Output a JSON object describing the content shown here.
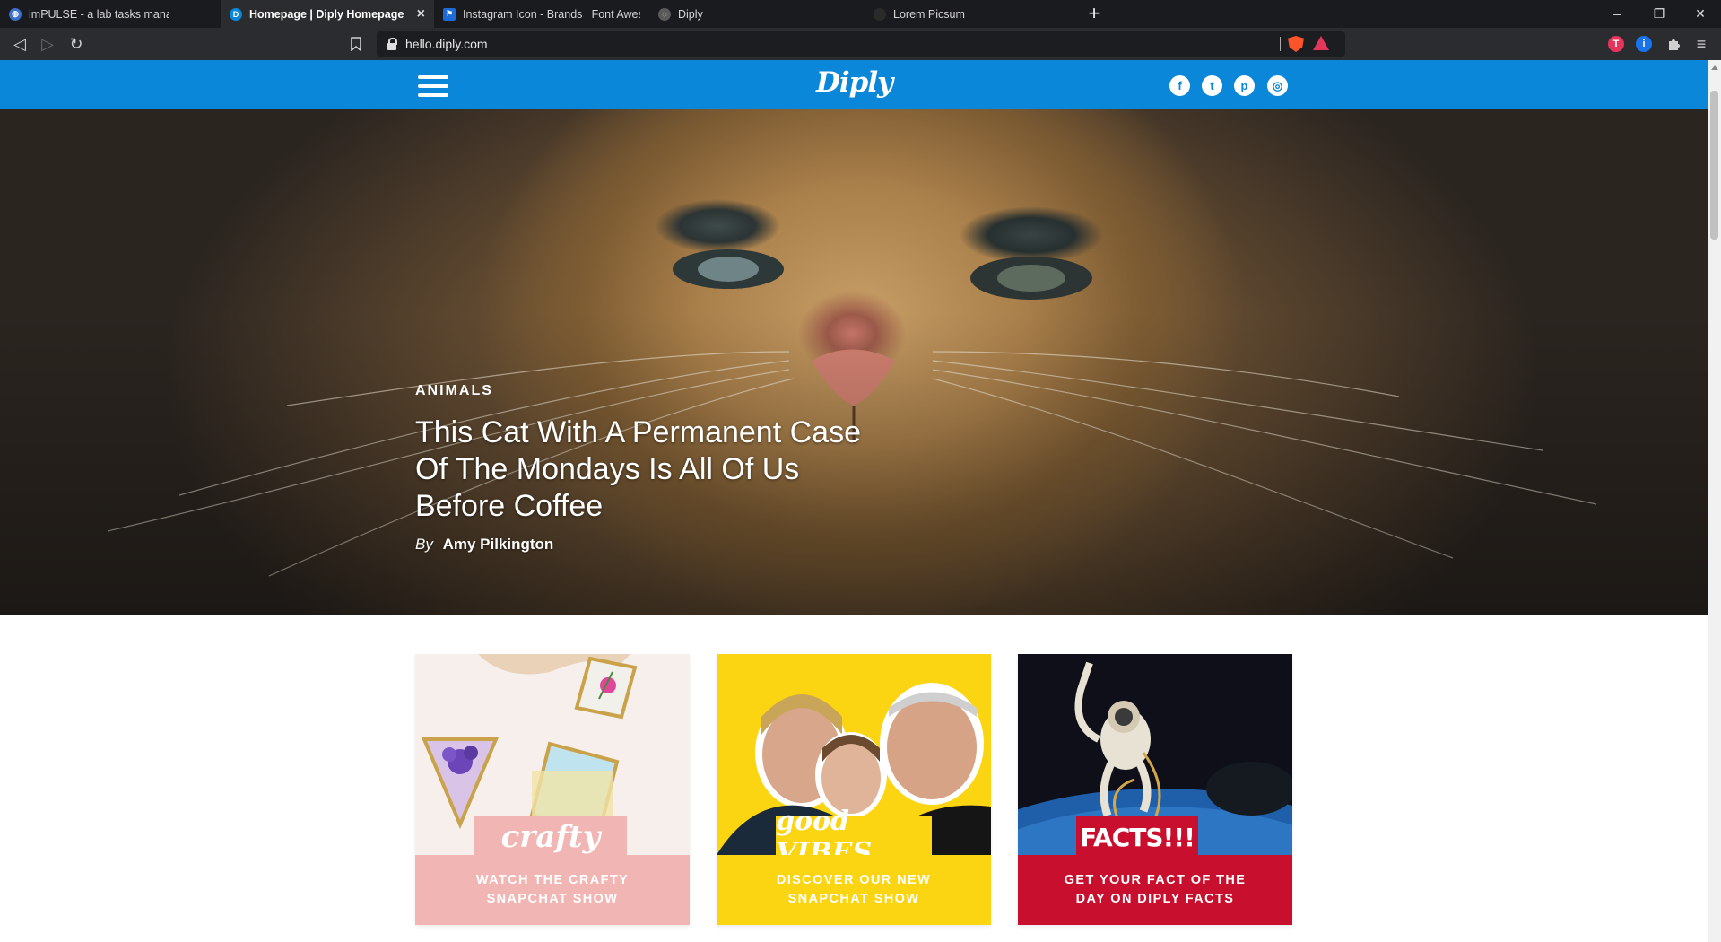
{
  "browser": {
    "tabs": [
      {
        "title": "imPULSE - a lab tasks management ap",
        "favicon_color": "#3a6fd0",
        "favicon_glyph": "◍",
        "active": false
      },
      {
        "title": "Homepage | Diply Homepage",
        "favicon_color": "#0a87d8",
        "favicon_glyph": "D",
        "active": true,
        "close": "×"
      },
      {
        "title": "Instagram Icon - Brands | Font Awesor",
        "favicon_color": "#1c6bd6",
        "favicon_glyph": "⚑",
        "active": false
      },
      {
        "title": "Diply",
        "favicon_color": "#5a5a5a",
        "favicon_glyph": "◌",
        "active": false
      },
      {
        "title": "Lorem Picsum",
        "favicon_color": "#2a2a2a",
        "favicon_glyph": "",
        "active": false
      }
    ],
    "new_tab": "+",
    "window_controls": {
      "minimize": "–",
      "restore": "❐",
      "close": "✕"
    },
    "nav": {
      "back": "◁",
      "forward": "▷",
      "reload": "↻",
      "bookmark": "🔖"
    },
    "url": "hello.diply.com",
    "extensions": [
      {
        "name": "brave-shields-icon",
        "color": "#fb542b"
      },
      {
        "name": "brave-rewards-icon",
        "color": "#e4365a"
      },
      {
        "name": "extension-t-icon",
        "glyph": "T",
        "color": "#e4365a"
      },
      {
        "name": "extension-1password-icon",
        "glyph": "i",
        "color": "#1a73e8"
      }
    ],
    "extensions_menu": "⚲",
    "main_menu": "≡"
  },
  "site": {
    "logo": "Diply",
    "brand_color": "#0a87d8",
    "social": [
      {
        "name": "facebook-icon",
        "glyph": "f"
      },
      {
        "name": "twitter-icon",
        "glyph": "t"
      },
      {
        "name": "pinterest-icon",
        "glyph": "p"
      },
      {
        "name": "instagram-icon",
        "glyph": "◎"
      }
    ]
  },
  "hero": {
    "category": "ANIMALS",
    "title": "This Cat With A Permanent Case Of The Mondays Is All Of Us Before Coffee",
    "by": "By",
    "author": "Amy Pilkington"
  },
  "cards": [
    {
      "badge": "crafty",
      "caption": "WATCH THE CRAFTY SNAPCHAT SHOW",
      "color": "#f1b5b3"
    },
    {
      "badge": "good VIBES",
      "caption": "DISCOVER OUR NEW SNAPCHAT SHOW",
      "color": "#fbd511"
    },
    {
      "badge": "FACTS!!!",
      "caption": "GET YOUR FACT OF THE DAY ON DIPLY FACTS",
      "color": "#c8102e"
    }
  ]
}
